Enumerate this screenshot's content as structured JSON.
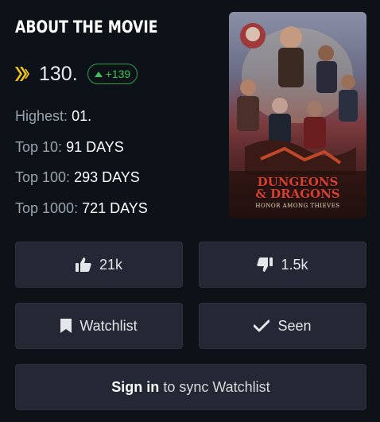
{
  "header": {
    "title": "ABOUT THE MOVIE"
  },
  "rank": {
    "value": "130.",
    "change": "+139"
  },
  "stats": [
    {
      "label": "Highest:",
      "value": "01."
    },
    {
      "label": "Top 10:",
      "value": "91 DAYS"
    },
    {
      "label": "Top 100:",
      "value": "293 DAYS"
    },
    {
      "label": "Top 1000:",
      "value": "721 DAYS"
    }
  ],
  "poster": {
    "title_line1": "DUNGEONS",
    "title_line2": "& DRAGONS",
    "subtitle": "HONOR AMONG THIEVES"
  },
  "actions": {
    "likes": "21k",
    "dislikes": "1.5k",
    "watchlist": "Watchlist",
    "seen": "Seen",
    "signin_bold": "Sign in",
    "signin_rest": "to sync Watchlist"
  },
  "colors": {
    "background": "#0d1219",
    "button": "#232834",
    "rank_icon": "#f5c518",
    "delta": "#40c057"
  },
  "icons": {
    "rank": "rank-chevrons-icon",
    "delta": "arrow-up-icon",
    "like": "thumbs-up-icon",
    "dislike": "thumbs-down-icon",
    "watchlist": "bookmark-icon",
    "seen": "checkmark-icon"
  }
}
